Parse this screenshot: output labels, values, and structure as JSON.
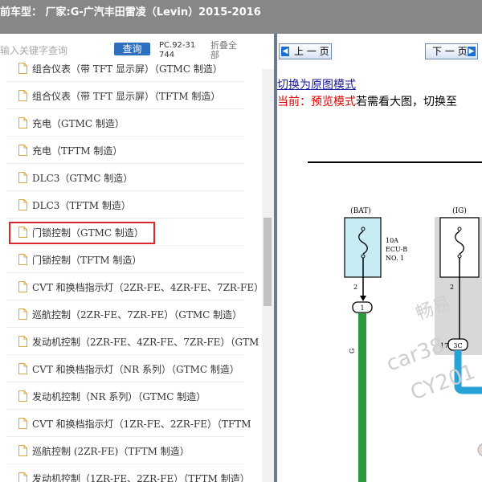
{
  "window": {
    "title": "前车型：  厂家:G-广汽丰田雷凌（Levin）2015-2016"
  },
  "search": {
    "placeholder": "输入关键字查询",
    "button_label": "查询",
    "code": "PC.92-31744",
    "collapse_label": "折叠全部"
  },
  "list": {
    "items": [
      {
        "label": "组合仪表（带 TFT 显示屏）（GTMC 制造）"
      },
      {
        "label": "组合仪表（带 TFT 显示屏）（TFTM 制造）"
      },
      {
        "label": "充电（GTMC 制造）"
      },
      {
        "label": "充电（TFTM 制造）"
      },
      {
        "label": "DLC3（GTMC 制造）"
      },
      {
        "label": "DLC3（TFTM 制造）"
      },
      {
        "label": "门锁控制（GTMC 制造）"
      },
      {
        "label": "门锁控制（TFTM 制造）"
      },
      {
        "label": "CVT 和换档指示灯（2ZR-FE、4ZR-FE、7ZR-FE）"
      },
      {
        "label": "巡航控制（2ZR-FE、7ZR-FE）（GTMC 制造）"
      },
      {
        "label": "发动机控制（2ZR-FE、4ZR-FE、7ZR-FE）（GTM"
      },
      {
        "label": "CVT 和换档指示灯（NR 系列）（GTMC 制造）"
      },
      {
        "label": "发动机控制（NR 系列）（GTMC 制造）"
      },
      {
        "label": "CVT 和换档指示灯（1ZR-FE、2ZR-FE）（TFTM"
      },
      {
        "label": "巡航控制 (2ZR-FE)（TFTM 制造）"
      },
      {
        "label": "发动机控制（1ZR-FE、2ZR-FE）（TFTM 制造）"
      }
    ],
    "highlighted_index": 6
  },
  "viewer": {
    "prev_label": "上 一 页",
    "next_label": "下 一 页",
    "switch_link": "切换为原图模式",
    "current_prefix": "当前：",
    "mode_label": "预览模式",
    "hint": "若需看大图，切换至"
  },
  "diagram": {
    "bat_label": "(BAT)",
    "ig_label": "(IG)",
    "fuse_amp": "10A",
    "fuse_name": "ECU-B",
    "fuse_no": "NO. 1",
    "pin_left": "2",
    "pin_right": "2",
    "connector_left": "1",
    "connector_right_pin": "17",
    "connector_right": "3C",
    "wire_left_color": "G",
    "watermark": [
      "畅易",
      "car38",
      "CY201"
    ],
    "colors": {
      "green_wire": "#2a9a3c",
      "blue_wire": "#29a3d6",
      "fuse_box": "#c8ecf4"
    }
  }
}
